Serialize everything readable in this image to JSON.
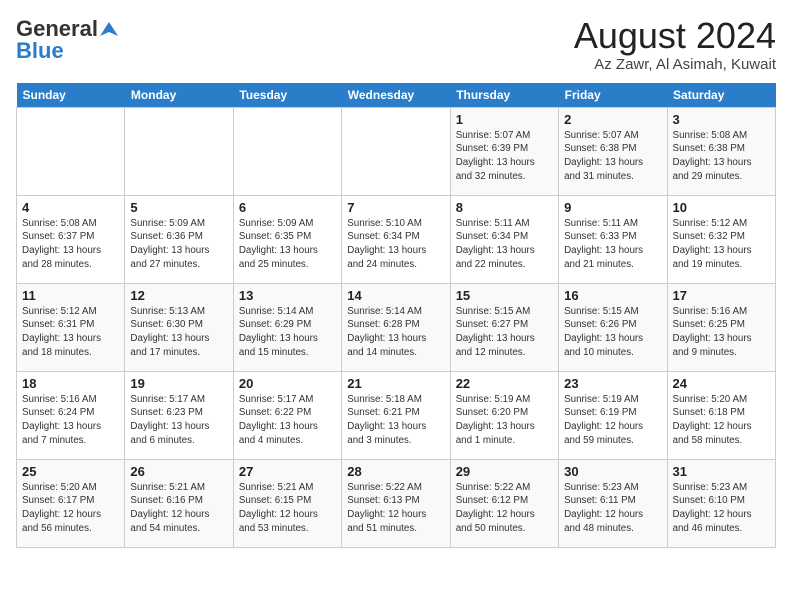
{
  "header": {
    "logo_general": "General",
    "logo_blue": "Blue",
    "month": "August 2024",
    "location": "Az Zawr, Al Asimah, Kuwait"
  },
  "days_of_week": [
    "Sunday",
    "Monday",
    "Tuesday",
    "Wednesday",
    "Thursday",
    "Friday",
    "Saturday"
  ],
  "weeks": [
    [
      {
        "day": "",
        "info": ""
      },
      {
        "day": "",
        "info": ""
      },
      {
        "day": "",
        "info": ""
      },
      {
        "day": "",
        "info": ""
      },
      {
        "day": "1",
        "info": "Sunrise: 5:07 AM\nSunset: 6:39 PM\nDaylight: 13 hours\nand 32 minutes."
      },
      {
        "day": "2",
        "info": "Sunrise: 5:07 AM\nSunset: 6:38 PM\nDaylight: 13 hours\nand 31 minutes."
      },
      {
        "day": "3",
        "info": "Sunrise: 5:08 AM\nSunset: 6:38 PM\nDaylight: 13 hours\nand 29 minutes."
      }
    ],
    [
      {
        "day": "4",
        "info": "Sunrise: 5:08 AM\nSunset: 6:37 PM\nDaylight: 13 hours\nand 28 minutes."
      },
      {
        "day": "5",
        "info": "Sunrise: 5:09 AM\nSunset: 6:36 PM\nDaylight: 13 hours\nand 27 minutes."
      },
      {
        "day": "6",
        "info": "Sunrise: 5:09 AM\nSunset: 6:35 PM\nDaylight: 13 hours\nand 25 minutes."
      },
      {
        "day": "7",
        "info": "Sunrise: 5:10 AM\nSunset: 6:34 PM\nDaylight: 13 hours\nand 24 minutes."
      },
      {
        "day": "8",
        "info": "Sunrise: 5:11 AM\nSunset: 6:34 PM\nDaylight: 13 hours\nand 22 minutes."
      },
      {
        "day": "9",
        "info": "Sunrise: 5:11 AM\nSunset: 6:33 PM\nDaylight: 13 hours\nand 21 minutes."
      },
      {
        "day": "10",
        "info": "Sunrise: 5:12 AM\nSunset: 6:32 PM\nDaylight: 13 hours\nand 19 minutes."
      }
    ],
    [
      {
        "day": "11",
        "info": "Sunrise: 5:12 AM\nSunset: 6:31 PM\nDaylight: 13 hours\nand 18 minutes."
      },
      {
        "day": "12",
        "info": "Sunrise: 5:13 AM\nSunset: 6:30 PM\nDaylight: 13 hours\nand 17 minutes."
      },
      {
        "day": "13",
        "info": "Sunrise: 5:14 AM\nSunset: 6:29 PM\nDaylight: 13 hours\nand 15 minutes."
      },
      {
        "day": "14",
        "info": "Sunrise: 5:14 AM\nSunset: 6:28 PM\nDaylight: 13 hours\nand 14 minutes."
      },
      {
        "day": "15",
        "info": "Sunrise: 5:15 AM\nSunset: 6:27 PM\nDaylight: 13 hours\nand 12 minutes."
      },
      {
        "day": "16",
        "info": "Sunrise: 5:15 AM\nSunset: 6:26 PM\nDaylight: 13 hours\nand 10 minutes."
      },
      {
        "day": "17",
        "info": "Sunrise: 5:16 AM\nSunset: 6:25 PM\nDaylight: 13 hours\nand 9 minutes."
      }
    ],
    [
      {
        "day": "18",
        "info": "Sunrise: 5:16 AM\nSunset: 6:24 PM\nDaylight: 13 hours\nand 7 minutes."
      },
      {
        "day": "19",
        "info": "Sunrise: 5:17 AM\nSunset: 6:23 PM\nDaylight: 13 hours\nand 6 minutes."
      },
      {
        "day": "20",
        "info": "Sunrise: 5:17 AM\nSunset: 6:22 PM\nDaylight: 13 hours\nand 4 minutes."
      },
      {
        "day": "21",
        "info": "Sunrise: 5:18 AM\nSunset: 6:21 PM\nDaylight: 13 hours\nand 3 minutes."
      },
      {
        "day": "22",
        "info": "Sunrise: 5:19 AM\nSunset: 6:20 PM\nDaylight: 13 hours\nand 1 minute."
      },
      {
        "day": "23",
        "info": "Sunrise: 5:19 AM\nSunset: 6:19 PM\nDaylight: 12 hours\nand 59 minutes."
      },
      {
        "day": "24",
        "info": "Sunrise: 5:20 AM\nSunset: 6:18 PM\nDaylight: 12 hours\nand 58 minutes."
      }
    ],
    [
      {
        "day": "25",
        "info": "Sunrise: 5:20 AM\nSunset: 6:17 PM\nDaylight: 12 hours\nand 56 minutes."
      },
      {
        "day": "26",
        "info": "Sunrise: 5:21 AM\nSunset: 6:16 PM\nDaylight: 12 hours\nand 54 minutes."
      },
      {
        "day": "27",
        "info": "Sunrise: 5:21 AM\nSunset: 6:15 PM\nDaylight: 12 hours\nand 53 minutes."
      },
      {
        "day": "28",
        "info": "Sunrise: 5:22 AM\nSunset: 6:13 PM\nDaylight: 12 hours\nand 51 minutes."
      },
      {
        "day": "29",
        "info": "Sunrise: 5:22 AM\nSunset: 6:12 PM\nDaylight: 12 hours\nand 50 minutes."
      },
      {
        "day": "30",
        "info": "Sunrise: 5:23 AM\nSunset: 6:11 PM\nDaylight: 12 hours\nand 48 minutes."
      },
      {
        "day": "31",
        "info": "Sunrise: 5:23 AM\nSunset: 6:10 PM\nDaylight: 12 hours\nand 46 minutes."
      }
    ]
  ]
}
